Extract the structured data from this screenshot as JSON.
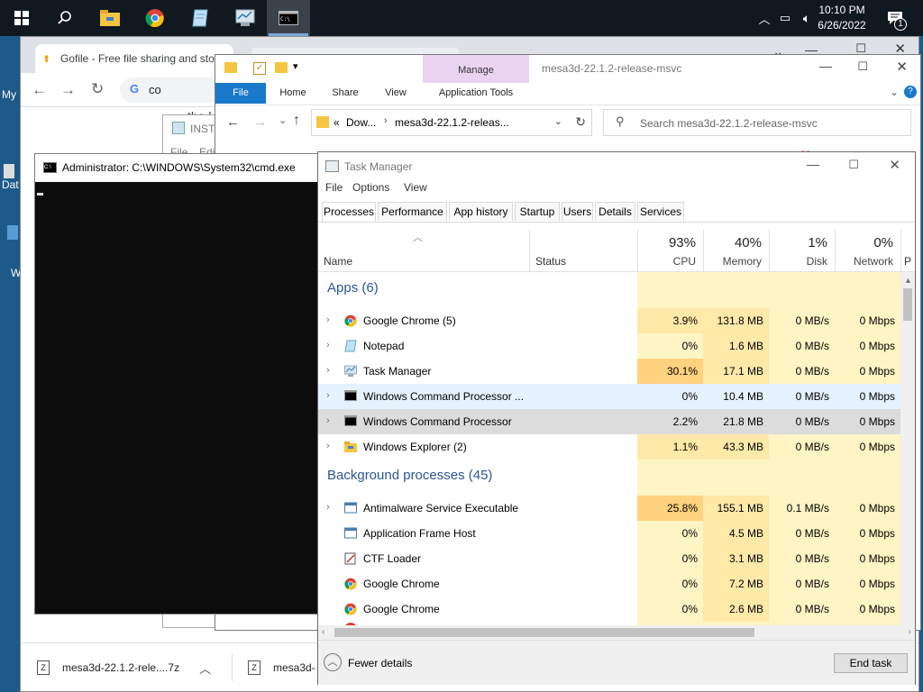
{
  "taskbar": {
    "clock_time": "10:10 PM",
    "clock_date": "6/26/2022",
    "notification_count": "1",
    "icons": [
      "windows-icon",
      "search-icon",
      "file-explorer-icon",
      "chrome-icon",
      "notepad-icon",
      "task-manager-icon",
      "cmd-icon"
    ]
  },
  "desktop": {
    "icon_labels": [
      "My",
      "Dat",
      "W"
    ]
  },
  "chrome": {
    "tab_title": "Gofile - Free file sharing and sto",
    "omnibox_text": "co",
    "page_text_1": "the l",
    "downloads": [
      {
        "label": "mesa3d-22.1.2-rele....7z"
      },
      {
        "label": "mesa3d-"
      }
    ]
  },
  "notepad": {
    "title": "INSTA",
    "menu": [
      "File",
      "Edit"
    ]
  },
  "explorer": {
    "title": "mesa3d-22.1.2-release-msvc",
    "ribbon_context_label": "Manage",
    "ribbon_tabs": [
      "File",
      "Home",
      "Share",
      "View",
      "Application Tools"
    ],
    "breadcrumb_prefix": "«",
    "breadcrumb": [
      "Dow...",
      "mesa3d-22.1.2-releas..."
    ],
    "search_placeholder": "Search mesa3d-22.1.2-release-msvc"
  },
  "cmd": {
    "title": "Administrator: C:\\WINDOWS\\System32\\cmd.exe"
  },
  "task_manager": {
    "title": "Task Manager",
    "menu": [
      "File",
      "Options",
      "View"
    ],
    "tabs": [
      "Processes",
      "Performance",
      "App history",
      "Startup",
      "Users",
      "Details",
      "Services"
    ],
    "columns": {
      "name": "Name",
      "status": "Status",
      "p_partial": "P",
      "cpu": {
        "pct": "93%",
        "label": "CPU"
      },
      "memory": {
        "pct": "40%",
        "label": "Memory"
      },
      "disk": {
        "pct": "1%",
        "label": "Disk"
      },
      "network": {
        "pct": "0%",
        "label": "Network"
      }
    },
    "groups": {
      "apps": "Apps (6)",
      "background": "Background processes (45)"
    },
    "apps": [
      {
        "name": "Google Chrome (5)",
        "cpu": "3.9%",
        "memory": "131.8 MB",
        "disk": "0 MB/s",
        "network": "0 Mbps",
        "icon": "chrome-icon"
      },
      {
        "name": "Notepad",
        "cpu": "0%",
        "memory": "1.6 MB",
        "disk": "0 MB/s",
        "network": "0 Mbps",
        "icon": "notepad-icon"
      },
      {
        "name": "Task Manager",
        "cpu": "30.1%",
        "memory": "17.1 MB",
        "disk": "0 MB/s",
        "network": "0 Mbps",
        "icon": "task-manager-icon"
      },
      {
        "name": "Windows Command Processor ...",
        "cpu": "0%",
        "memory": "10.4 MB",
        "disk": "0 MB/s",
        "network": "0 Mbps",
        "icon": "cmd-icon"
      },
      {
        "name": "Windows Command Processor",
        "cpu": "2.2%",
        "memory": "21.8 MB",
        "disk": "0 MB/s",
        "network": "0 Mbps",
        "icon": "cmd-icon"
      },
      {
        "name": "Windows Explorer (2)",
        "cpu": "1.1%",
        "memory": "43.3 MB",
        "disk": "0 MB/s",
        "network": "0 Mbps",
        "icon": "folder-icon"
      }
    ],
    "background": [
      {
        "name": "Antimalware Service Executable",
        "cpu": "25.8%",
        "memory": "155.1 MB",
        "disk": "0.1 MB/s",
        "network": "0 Mbps",
        "icon": "service-icon"
      },
      {
        "name": "Application Frame Host",
        "cpu": "0%",
        "memory": "4.5 MB",
        "disk": "0 MB/s",
        "network": "0 Mbps",
        "icon": "service-icon"
      },
      {
        "name": "CTF Loader",
        "cpu": "0%",
        "memory": "3.1 MB",
        "disk": "0 MB/s",
        "network": "0 Mbps",
        "icon": "ctf-icon"
      },
      {
        "name": "Google Chrome",
        "cpu": "0%",
        "memory": "7.2 MB",
        "disk": "0 MB/s",
        "network": "0 Mbps",
        "icon": "chrome-icon"
      },
      {
        "name": "Google Chrome",
        "cpu": "0%",
        "memory": "2.6 MB",
        "disk": "0 MB/s",
        "network": "0 Mbps",
        "icon": "chrome-icon"
      }
    ],
    "fewer_details": "Fewer details",
    "end_task": "End task",
    "colors": {
      "heat_low": "#fff4c4",
      "heat_mid": "#ffe9a8",
      "heat_high": "#ffd27f",
      "group_text": "#2b5797",
      "selected_row": "#dcdcdc",
      "hover_row": "#e5f3ff"
    }
  }
}
